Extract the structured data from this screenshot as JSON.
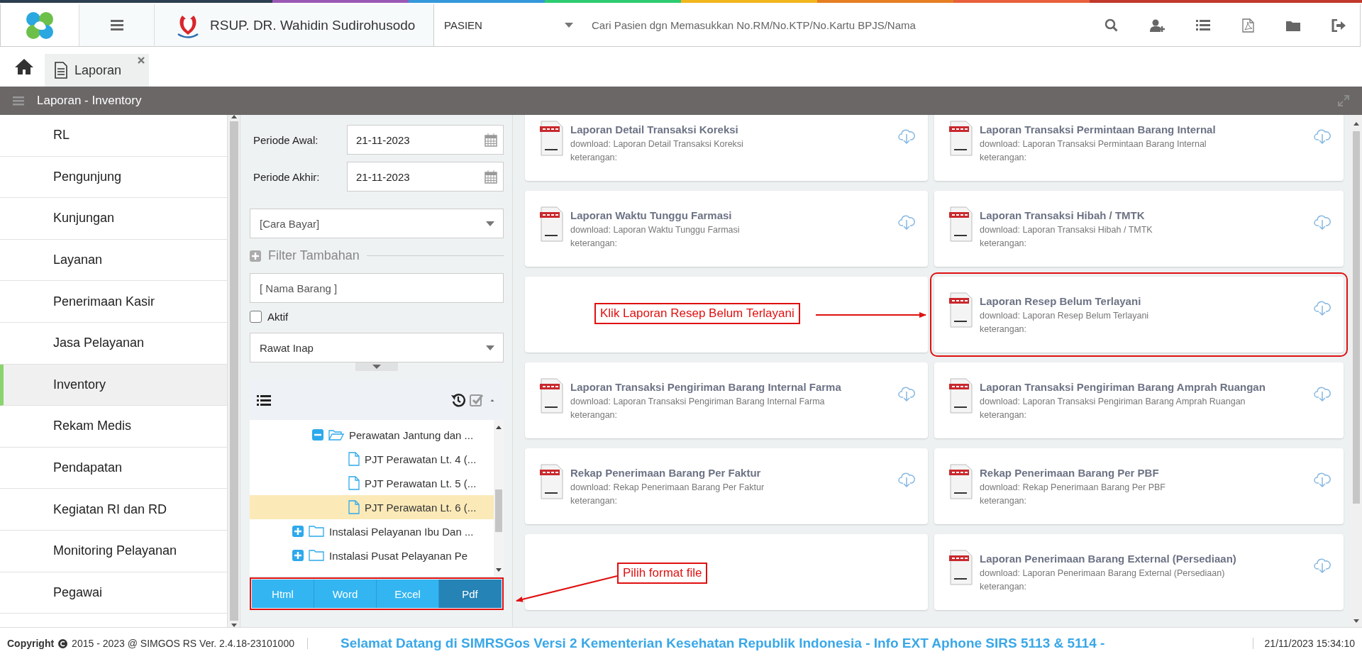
{
  "header": {
    "hospital_name": "RSUP. DR. Wahidin Sudirohusodo",
    "category": {
      "value": "PASIEN"
    },
    "search": {
      "placeholder": "Cari Pasien dgn Memasukkan No.RM/No.KTP/No.Kartu BPJS/Nama"
    }
  },
  "tabs": [
    {
      "label": "Laporan",
      "selected": true
    }
  ],
  "title_bar": {
    "title": "Laporan - Inventory"
  },
  "sidebar": {
    "items": [
      {
        "label": "RL",
        "selected": false
      },
      {
        "label": "Pengunjung",
        "selected": false
      },
      {
        "label": "Kunjungan",
        "selected": false
      },
      {
        "label": "Layanan",
        "selected": false
      },
      {
        "label": "Penerimaan Kasir",
        "selected": false
      },
      {
        "label": "Jasa Pelayanan",
        "selected": false
      },
      {
        "label": "Inventory",
        "selected": true
      },
      {
        "label": "Rekam Medis",
        "selected": false
      },
      {
        "label": "Pendapatan",
        "selected": false
      },
      {
        "label": "Kegiatan RI dan RD",
        "selected": false
      },
      {
        "label": "Monitoring Pelayanan",
        "selected": false
      },
      {
        "label": "Pegawai",
        "selected": false
      }
    ]
  },
  "filters": {
    "periode_awal": {
      "label": "Periode Awal:",
      "value": "21-11-2023"
    },
    "periode_akhir": {
      "label": "Periode Akhir:",
      "value": "21-11-2023"
    },
    "cara_bayar": {
      "placeholder": "[Cara Bayar]"
    },
    "filter_tambahan": {
      "label": "Filter Tambahan"
    },
    "nama_barang": {
      "placeholder": "[ Nama Barang ]"
    },
    "aktif": {
      "label": "Aktif",
      "checked": false
    },
    "jenis": {
      "value": "Rawat Inap"
    }
  },
  "tree": [
    {
      "label": "Perawatan Jantung dan ...",
      "expanded": true,
      "selected": false,
      "children": [
        {
          "label": "PJT Perawatan Lt. 4 (...",
          "selected": false
        },
        {
          "label": "PJT Perawatan Lt. 5 (...",
          "selected": false
        },
        {
          "label": "PJT Perawatan Lt. 6 (...",
          "selected": true
        }
      ]
    },
    {
      "label": "Instalasi Pelayanan Ibu Dan ...",
      "expanded": false,
      "selected": false
    },
    {
      "label": "Instalasi Pusat Pelayanan Pe",
      "expanded": false,
      "selected": false
    }
  ],
  "formats": {
    "highlighted": true,
    "items": [
      {
        "label": "Html",
        "selected": false
      },
      {
        "label": "Word",
        "selected": false
      },
      {
        "label": "Excel",
        "selected": false
      },
      {
        "label": "Pdf",
        "selected": true
      }
    ]
  },
  "reports": [
    {
      "kind": "report",
      "title": "Laporan Detail Transaksi Koreksi",
      "download": "download: Laporan Detail Transaksi Koreksi",
      "note": "keterangan:",
      "highlighted": false
    },
    {
      "kind": "report",
      "title": "Laporan Transaksi Permintaan Barang Internal",
      "download": "download: Laporan Transaksi Permintaan Barang Internal",
      "note": "keterangan:",
      "highlighted": false
    },
    {
      "kind": "report",
      "title": "Laporan Waktu Tunggu Farmasi",
      "download": "download: Laporan Waktu Tunggu Farmasi",
      "note": "keterangan:",
      "highlighted": false
    },
    {
      "kind": "report",
      "title": "Laporan Transaksi Hibah / TMTK",
      "download": "download: Laporan Transaksi Hibah / TMTK",
      "note": "keterangan:",
      "highlighted": false
    },
    {
      "kind": "empty"
    },
    {
      "kind": "report",
      "title": "Laporan Resep Belum Terlayani",
      "download": "download: Laporan Resep Belum Terlayani",
      "note": "keterangan:",
      "highlighted": true
    },
    {
      "kind": "report",
      "title": "Laporan Transaksi Pengiriman Barang Internal Farma",
      "download": "download: Laporan Transaksi Pengiriman Barang Internal Farma",
      "note": "keterangan:",
      "highlighted": false
    },
    {
      "kind": "report",
      "title": "Laporan Transaksi Pengiriman Barang Amprah Ruangan",
      "download": "download: Laporan Transaksi Pengiriman Barang Amprah Ruangan",
      "note": "keterangan:",
      "highlighted": false
    },
    {
      "kind": "report",
      "title": "Rekap Penerimaan Barang Per Faktur",
      "download": "download: Rekap Penerimaan Barang Per Faktur",
      "note": "keterangan:",
      "highlighted": false
    },
    {
      "kind": "report",
      "title": "Rekap Penerimaan Barang Per PBF",
      "download": "download: Rekap Penerimaan Barang Per PBF",
      "note": "keterangan:",
      "highlighted": false
    },
    {
      "kind": "empty"
    },
    {
      "kind": "report",
      "title": "Laporan Penerimaan Barang External (Persediaan)",
      "download": "download: Laporan Penerimaan Barang External (Persediaan)",
      "note": "keterangan:",
      "highlighted": false
    }
  ],
  "annotations": [
    {
      "text": "Klik Laporan Resep Belum Terlayani"
    },
    {
      "text": "Pilih format file"
    }
  ],
  "footer": {
    "copyright_label": "Copyright",
    "copyright": "2015 - 2023 @ SIMGOS RS Ver. 2.4.18-23101000",
    "marquee": "Selamat Datang di SIMRSGos Versi 2 Kementerian Kesehatan Republik Indonesia - Info EXT Aphone SIRS 5113 & 5114 -",
    "datetime": "21/11/2023 15:34:10"
  }
}
